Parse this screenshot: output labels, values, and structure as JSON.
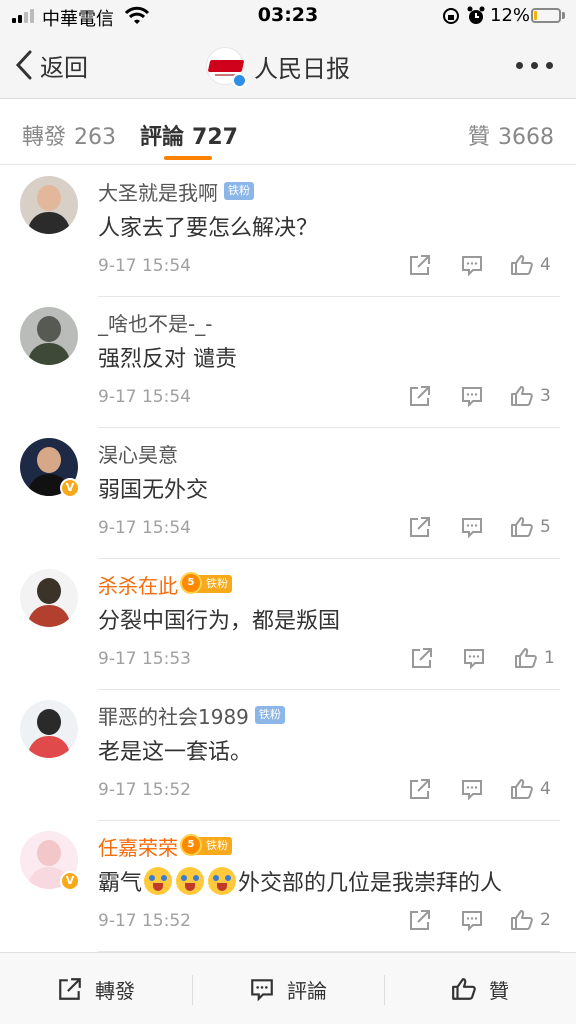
{
  "status_bar": {
    "carrier": "中華電信",
    "time": "03:23",
    "battery_percent": "12%",
    "battery_level": 0.12,
    "battery_color": "#f5b400"
  },
  "nav": {
    "back_label": "返回",
    "title": "人民日报",
    "back_icon": "chevron-left-icon",
    "more_icon": "more-dots-icon"
  },
  "tabs": {
    "repost_label": "轉發",
    "repost_count": "263",
    "comment_label": "評論",
    "comment_count": "727",
    "like_label": "贊",
    "like_count": "3668",
    "active": "comment",
    "accent_color": "#ff8200"
  },
  "comments": [
    {
      "name": "大圣就是我啊",
      "badge": "铁粉",
      "text": "人家去了要怎么解决？",
      "time": "9-17 15:54",
      "likes": "4"
    },
    {
      "name": "_啥也不是-_-",
      "text": "强烈反对 谴责",
      "time": "9-17 15:54",
      "likes": "3"
    },
    {
      "name": "淏心昊意",
      "text": "弱国无外交",
      "time": "9-17 15:54",
      "likes": "5"
    },
    {
      "name": "杀杀在此",
      "badge": "铁粉",
      "text": "分裂中国行为，都是叛国",
      "time": "9-17 15:53",
      "likes": "1"
    },
    {
      "name": "罪恶的社会1989",
      "badge": "铁粉",
      "text": "老是这一套话。",
      "time": "9-17 15:52",
      "likes": "4"
    },
    {
      "name": "任嘉荣荣",
      "badge": "铁粉",
      "text_prefix": "霸气",
      "text_suffix": "外交部的几位是我崇拜的人",
      "emoji": "crying-laughing-emoji",
      "time": "9-17 15:52",
      "likes": "2"
    }
  ],
  "toolbar": {
    "repost_label": "轉發",
    "comment_label": "評論",
    "like_label": "贊"
  },
  "colors": {
    "vip_name": "#f86b0a",
    "verified_orange": "#f7a81b",
    "verified_blue": "#2f8ee6",
    "fan_tag": "#8cb6e8"
  }
}
